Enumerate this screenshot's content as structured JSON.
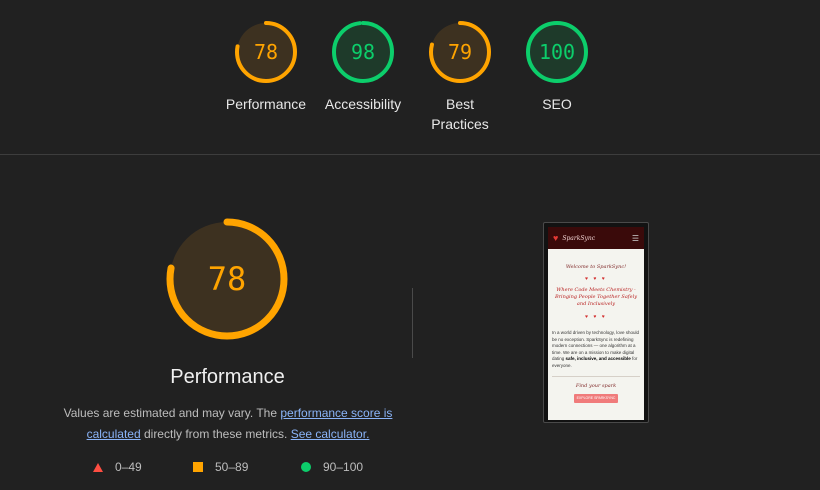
{
  "colors": {
    "background": "#212121",
    "pass": "#0cce6b",
    "average": "#ffa400",
    "fail": "#ff4e42",
    "link": "#8ab4f8"
  },
  "summary": [
    {
      "label": "Performance",
      "score": "78",
      "status": "average"
    },
    {
      "label": "Accessibility",
      "score": "98",
      "status": "pass"
    },
    {
      "label": "Best Practices",
      "score": "79",
      "status": "average"
    },
    {
      "label": "SEO",
      "score": "100",
      "status": "pass"
    }
  ],
  "performance": {
    "score": "78",
    "status": "average",
    "title": "Performance",
    "desc_prefix": "Values are estimated and may vary. The ",
    "desc_link1": "performance score is calculated",
    "desc_middle": " directly from these metrics. ",
    "desc_link2": "See calculator."
  },
  "legend": [
    {
      "range": "0–49",
      "icon": "triangle-icon",
      "status": "fail"
    },
    {
      "range": "50–89",
      "icon": "square-icon",
      "status": "average"
    },
    {
      "range": "90–100",
      "icon": "circle-icon",
      "status": "pass"
    }
  ],
  "preview": {
    "brand": "SparkSync",
    "welcome": "Welcome to SparkSync!",
    "hearts": "♥ ♥ ♥",
    "tagline": "Where Code Meets Chemistry - Bringing People Together Safely and Inclusively",
    "body_start": "In a world driven by technology, love should be no exception. SparkSync is redefining modern connections — one algorithm at a time. We are on a mission to make digital dating ",
    "body_bold1": "safe, inclusive, and accessible",
    "body_end": " for everyone.",
    "find": "Find your spark",
    "button": "EXPLORE SPARKSYNC"
  }
}
